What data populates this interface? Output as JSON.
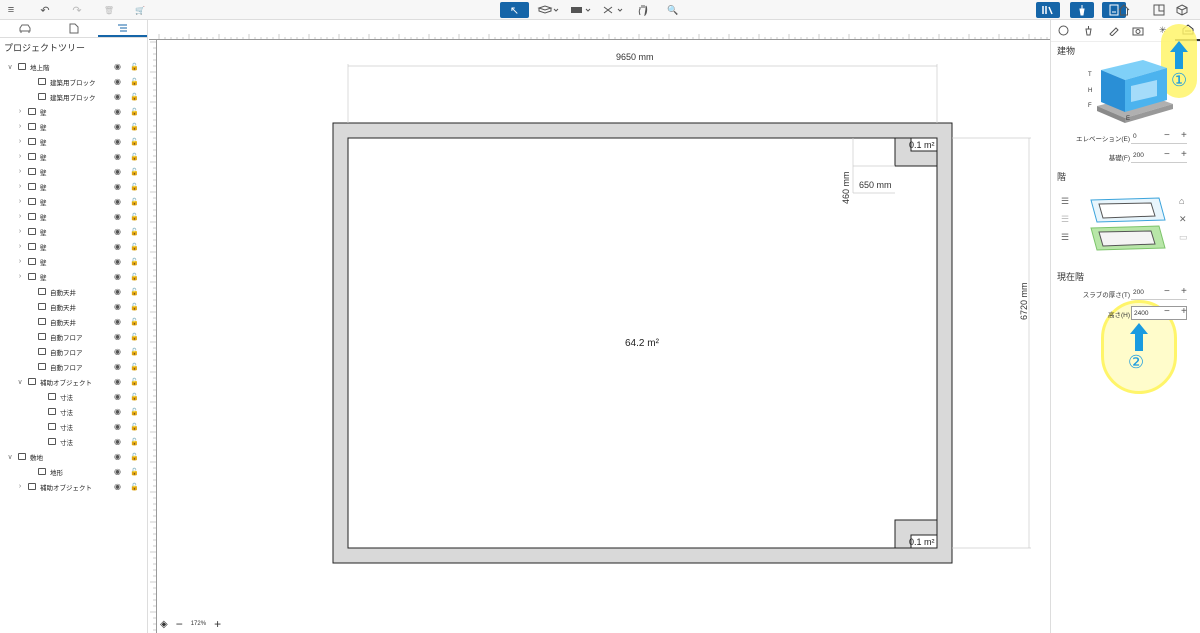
{
  "toolbar": {
    "menu": "≡",
    "undo": "↶",
    "redo": "↷",
    "trash": "🗑",
    "cart": "🛒",
    "select": "↖",
    "zoom_search": "🔍"
  },
  "left": {
    "title": "プロジェクトツリー",
    "rows": [
      {
        "label": "地上階",
        "indent": 0,
        "chev": "∨"
      },
      {
        "label": "建築用ブロック",
        "indent": 2,
        "chev": ""
      },
      {
        "label": "建築用ブロック",
        "indent": 2,
        "chev": ""
      },
      {
        "label": "壁",
        "indent": 1,
        "chev": "›"
      },
      {
        "label": "壁",
        "indent": 1,
        "chev": "›"
      },
      {
        "label": "壁",
        "indent": 1,
        "chev": "›"
      },
      {
        "label": "壁",
        "indent": 1,
        "chev": "›"
      },
      {
        "label": "壁",
        "indent": 1,
        "chev": "›"
      },
      {
        "label": "壁",
        "indent": 1,
        "chev": "›"
      },
      {
        "label": "壁",
        "indent": 1,
        "chev": "›"
      },
      {
        "label": "壁",
        "indent": 1,
        "chev": "›"
      },
      {
        "label": "壁",
        "indent": 1,
        "chev": "›"
      },
      {
        "label": "壁",
        "indent": 1,
        "chev": "›"
      },
      {
        "label": "壁",
        "indent": 1,
        "chev": "›"
      },
      {
        "label": "壁",
        "indent": 1,
        "chev": "›"
      },
      {
        "label": "自動天井",
        "indent": 2,
        "chev": ""
      },
      {
        "label": "自動天井",
        "indent": 2,
        "chev": ""
      },
      {
        "label": "自動天井",
        "indent": 2,
        "chev": ""
      },
      {
        "label": "自動フロア",
        "indent": 2,
        "chev": ""
      },
      {
        "label": "自動フロア",
        "indent": 2,
        "chev": ""
      },
      {
        "label": "自動フロア",
        "indent": 2,
        "chev": ""
      },
      {
        "label": "補助オブジェクト",
        "indent": 1,
        "chev": "∨"
      },
      {
        "label": "寸法",
        "indent": 3,
        "chev": ""
      },
      {
        "label": "寸法",
        "indent": 3,
        "chev": ""
      },
      {
        "label": "寸法",
        "indent": 3,
        "chev": ""
      },
      {
        "label": "寸法",
        "indent": 3,
        "chev": ""
      },
      {
        "label": "敷地",
        "indent": 0,
        "chev": "∨"
      },
      {
        "label": "地形",
        "indent": 2,
        "chev": ""
      },
      {
        "label": "補助オブジェクト",
        "indent": 1,
        "chev": "›"
      }
    ]
  },
  "canvas": {
    "width_dim": "9650 mm",
    "height_dim": "6720 mm",
    "notch_h": "460 mm",
    "notch_w": "650 mm",
    "area": "64.2 m²",
    "small_top": "0.1 m²",
    "small_bottom": "0.1 m²",
    "zoom": "172%"
  },
  "right": {
    "building_title": "建物",
    "labels": {
      "t": "T",
      "h": "H",
      "f": "F",
      "e": "E"
    },
    "elevation_label": "エレベーション(E)",
    "elevation_value": "0",
    "foundation_label": "基礎(F)",
    "foundation_value": "200",
    "floor_title": "階",
    "current_title": "現在階",
    "slab_label": "スラブの厚さ(T)",
    "slab_value": "200",
    "height_label": "高さ(H)",
    "height_value": "2400",
    "marker1": "①",
    "marker2": "②"
  }
}
